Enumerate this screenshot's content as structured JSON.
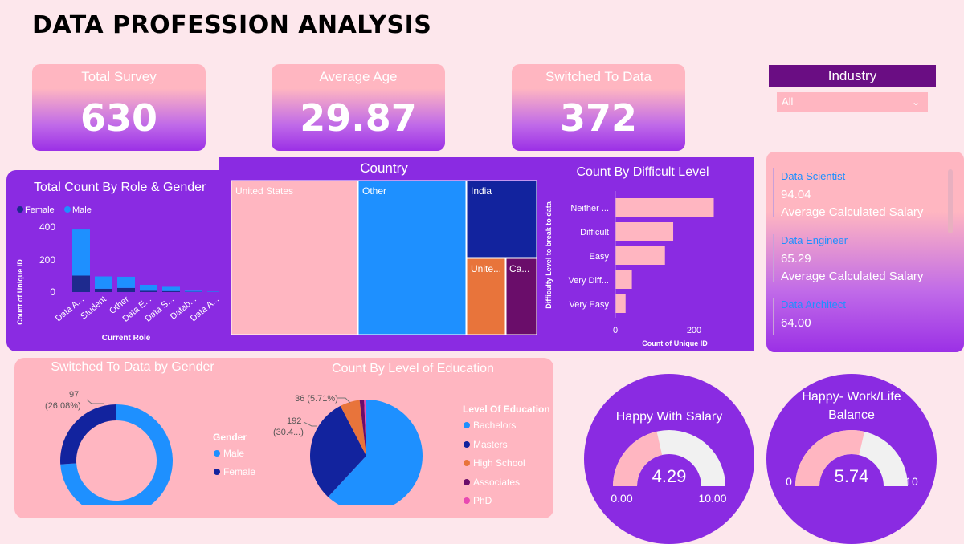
{
  "title": "DATA PROFESSION ANALYSIS",
  "kpis": [
    {
      "label": "Total Survey",
      "value": "630"
    },
    {
      "label": "Average Age",
      "value": "29.87"
    },
    {
      "label": "Switched To Data",
      "value": "372"
    }
  ],
  "industry": {
    "label": "Industry",
    "selected": "All"
  },
  "salary_cards": [
    {
      "role": "Data Scientist",
      "value": "94.04",
      "caption": "Average Calculated Salary"
    },
    {
      "role": "Data Engineer",
      "value": "65.29",
      "caption": "Average Calculated Salary"
    },
    {
      "role": "Data Architect",
      "value": "64.00"
    }
  ],
  "colors": {
    "female": "#1e2a8e",
    "male": "#1e90ff",
    "pink": "#ffb6c1",
    "purple": "#8a2be2",
    "orange": "#e8743b",
    "darkpurple": "#6a0d6a",
    "navy": "#12239e"
  },
  "chart_data": [
    {
      "type": "bar",
      "title": "Total Count By Role & Gender",
      "legend": [
        "Female",
        "Male"
      ],
      "legend_placement": "top-left",
      "xlabel": "Current Role",
      "ylabel": "Count of Unique ID",
      "categories": [
        "Data A...",
        "Student",
        "Other",
        "Data E...",
        "Data S...",
        "Datab...",
        "Data A..."
      ],
      "yticks": [
        "0",
        "200",
        "400"
      ],
      "ylim": [
        0,
        430
      ],
      "series": [
        {
          "name": "Female",
          "values": [
            100,
            20,
            25,
            8,
            6,
            2,
            1
          ]
        },
        {
          "name": "Male",
          "values": [
            280,
            75,
            68,
            36,
            26,
            6,
            3
          ]
        }
      ]
    },
    {
      "type": "treemap",
      "title": "Country",
      "labels": [
        "United States",
        "Other",
        "India",
        "Unite...",
        "Ca..."
      ],
      "values": [
        262,
        226,
        84,
        32,
        26
      ]
    },
    {
      "type": "bar",
      "orientation": "horizontal",
      "title": "Count By Difficult Level",
      "categories": [
        "Neither ...",
        "Difficult",
        "Easy",
        "Very Diff...",
        "Very Easy"
      ],
      "values": [
        250,
        147,
        126,
        42,
        26
      ],
      "xticks": [
        "0",
        "200"
      ],
      "xlim": [
        0,
        280
      ],
      "xlabel": "Count of Unique ID",
      "ylabel": "Difficulty Level to break to data"
    },
    {
      "type": "pie",
      "title": "Switched To Data by Gender",
      "legend_title": "Gender",
      "labels": [
        "Male",
        "Female"
      ],
      "values": [
        275,
        97
      ],
      "data_labels": [
        "97",
        "(26.08%)"
      ]
    },
    {
      "type": "pie",
      "title": "Count By Level of Education",
      "legend_title": "Level Of Education",
      "labels": [
        "Bachelors",
        "Masters",
        "High School",
        "Associates",
        "PhD"
      ],
      "values": [
        390,
        192,
        36,
        8,
        4
      ],
      "data_labels": [
        "36 (5.71%)",
        "192",
        "(30.4...)"
      ]
    }
  ],
  "gauges": [
    {
      "title": "Happy With Salary",
      "value": 4.29,
      "min_label": "0.00",
      "max_label": "10.00",
      "value_label": "4.29"
    },
    {
      "title_line1": "Happy- Work/Life",
      "title_line2": "Balance",
      "value": 5.74,
      "min_label": "0",
      "max_label": "10",
      "value_label": "5.74"
    }
  ]
}
